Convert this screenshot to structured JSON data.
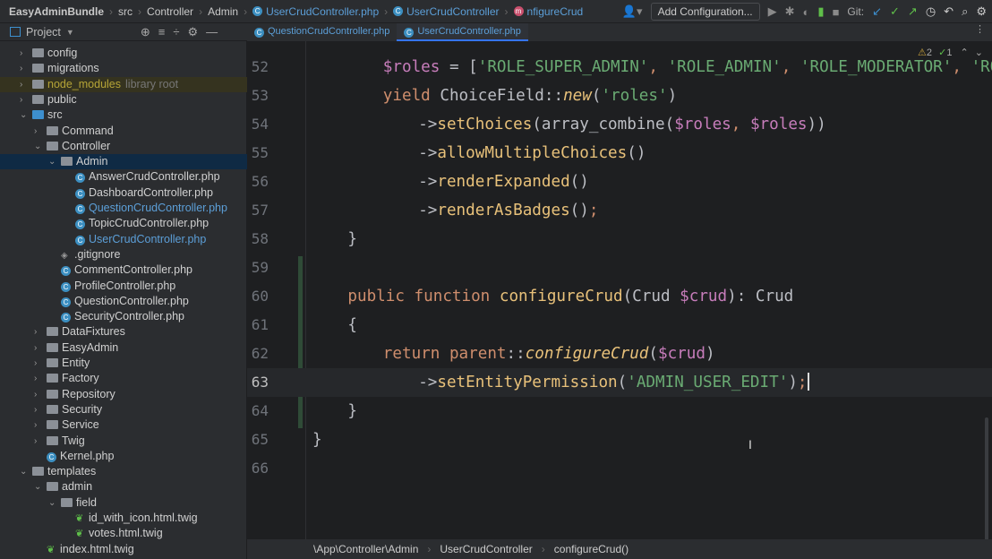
{
  "breadcrumb": [
    "EasyAdminBundle",
    "src",
    "Controller",
    "Admin",
    "UserCrudController.php",
    "UserCrudController",
    "nfigureCrud"
  ],
  "toolbar": {
    "add_config": "Add Configuration...",
    "git_label": "Git:"
  },
  "project": {
    "label": "Project"
  },
  "tabs": [
    {
      "label": "QuestionCrudController.php",
      "active": false
    },
    {
      "label": "UserCrudController.php",
      "active": true
    }
  ],
  "tree": [
    {
      "label": "config",
      "depth": 0,
      "type": "folder",
      "arrow": "›"
    },
    {
      "label": "migrations",
      "depth": 0,
      "type": "folder",
      "arrow": "›"
    },
    {
      "label": "node_modules",
      "extra": "library root",
      "depth": 0,
      "type": "lib",
      "arrow": "›"
    },
    {
      "label": "public",
      "depth": 0,
      "type": "folder",
      "arrow": "›"
    },
    {
      "label": "src",
      "depth": 0,
      "type": "src",
      "arrow": "⌄"
    },
    {
      "label": "Command",
      "depth": 1,
      "type": "folder",
      "arrow": "›"
    },
    {
      "label": "Controller",
      "depth": 1,
      "type": "folder",
      "arrow": "⌄"
    },
    {
      "label": "Admin",
      "depth": 2,
      "type": "folder",
      "arrow": "⌄",
      "selected": true
    },
    {
      "label": "AnswerCrudController.php",
      "depth": 3,
      "type": "php"
    },
    {
      "label": "DashboardController.php",
      "depth": 3,
      "type": "php"
    },
    {
      "label": "QuestionCrudController.php",
      "depth": 3,
      "type": "php",
      "modified": true
    },
    {
      "label": "TopicCrudController.php",
      "depth": 3,
      "type": "php"
    },
    {
      "label": "UserCrudController.php",
      "depth": 3,
      "type": "php",
      "modified": true
    },
    {
      "label": ".gitignore",
      "depth": 2,
      "type": "git"
    },
    {
      "label": "CommentController.php",
      "depth": 2,
      "type": "php"
    },
    {
      "label": "ProfileController.php",
      "depth": 2,
      "type": "php"
    },
    {
      "label": "QuestionController.php",
      "depth": 2,
      "type": "php"
    },
    {
      "label": "SecurityController.php",
      "depth": 2,
      "type": "php"
    },
    {
      "label": "DataFixtures",
      "depth": 1,
      "type": "folder",
      "arrow": "›"
    },
    {
      "label": "EasyAdmin",
      "depth": 1,
      "type": "folder",
      "arrow": "›"
    },
    {
      "label": "Entity",
      "depth": 1,
      "type": "folder",
      "arrow": "›"
    },
    {
      "label": "Factory",
      "depth": 1,
      "type": "folder",
      "arrow": "›"
    },
    {
      "label": "Repository",
      "depth": 1,
      "type": "folder",
      "arrow": "›"
    },
    {
      "label": "Security",
      "depth": 1,
      "type": "folder",
      "arrow": "›"
    },
    {
      "label": "Service",
      "depth": 1,
      "type": "folder",
      "arrow": "›"
    },
    {
      "label": "Twig",
      "depth": 1,
      "type": "folder",
      "arrow": "›"
    },
    {
      "label": "Kernel.php",
      "depth": 1,
      "type": "php"
    },
    {
      "label": "templates",
      "depth": 0,
      "type": "folder",
      "arrow": "⌄"
    },
    {
      "label": "admin",
      "depth": 1,
      "type": "folder",
      "arrow": "⌄"
    },
    {
      "label": "field",
      "depth": 2,
      "type": "folder",
      "arrow": "⌄"
    },
    {
      "label": "id_with_icon.html.twig",
      "depth": 3,
      "type": "twig"
    },
    {
      "label": "votes.html.twig",
      "depth": 3,
      "type": "twig"
    },
    {
      "label": "index.html.twig",
      "depth": 1,
      "type": "twig"
    }
  ],
  "inspections": {
    "warnings": "2",
    "ok": "1"
  },
  "code": [
    {
      "n": "52",
      "indent": 2,
      "t": [
        [
          "var",
          "$roles"
        ],
        [
          "txt",
          " = ["
        ],
        [
          "str",
          "'ROLE_SUPER_ADMIN'"
        ],
        [
          "comma",
          ", "
        ],
        [
          "str",
          "'ROLE_ADMIN'"
        ],
        [
          "comma",
          ", "
        ],
        [
          "str",
          "'ROLE_MODERATOR'"
        ],
        [
          "comma",
          ", "
        ],
        [
          "str",
          "'ROLE_U"
        ]
      ]
    },
    {
      "n": "53",
      "indent": 2,
      "t": [
        [
          "kw",
          "yield "
        ],
        [
          "txt",
          "ChoiceField::"
        ],
        [
          "it",
          "new"
        ],
        [
          "txt",
          "("
        ],
        [
          "str",
          "'roles'"
        ],
        [
          "txt",
          ")"
        ]
      ]
    },
    {
      "n": "54",
      "indent": 3,
      "t": [
        [
          "txt",
          "->"
        ],
        [
          "fn",
          "setChoices"
        ],
        [
          "txt",
          "(array_combine("
        ],
        [
          "var",
          "$roles"
        ],
        [
          "comma",
          ", "
        ],
        [
          "var",
          "$roles"
        ],
        [
          "txt",
          "))"
        ]
      ]
    },
    {
      "n": "55",
      "indent": 3,
      "t": [
        [
          "txt",
          "->"
        ],
        [
          "fn",
          "allowMultipleChoices"
        ],
        [
          "txt",
          "()"
        ]
      ]
    },
    {
      "n": "56",
      "indent": 3,
      "t": [
        [
          "txt",
          "->"
        ],
        [
          "fn",
          "renderExpanded"
        ],
        [
          "txt",
          "()"
        ]
      ]
    },
    {
      "n": "57",
      "indent": 3,
      "t": [
        [
          "txt",
          "->"
        ],
        [
          "fn",
          "renderAsBadges"
        ],
        [
          "txt",
          "()"
        ],
        [
          "comma",
          ";"
        ]
      ]
    },
    {
      "n": "58",
      "indent": 1,
      "t": [
        [
          "txt",
          "}"
        ]
      ]
    },
    {
      "n": "59",
      "indent": 0,
      "t": []
    },
    {
      "n": "60",
      "indent": 1,
      "t": [
        [
          "kw",
          "public function "
        ],
        [
          "fn",
          "configureCrud"
        ],
        [
          "txt",
          "(Crud "
        ],
        [
          "var",
          "$crud"
        ],
        [
          "txt",
          "): Crud"
        ]
      ]
    },
    {
      "n": "61",
      "indent": 1,
      "t": [
        [
          "txt",
          "{"
        ]
      ]
    },
    {
      "n": "62",
      "indent": 2,
      "t": [
        [
          "kw",
          "return "
        ],
        [
          "kw",
          "parent"
        ],
        [
          "txt",
          "::"
        ],
        [
          "it",
          "configureCrud"
        ],
        [
          "txt",
          "("
        ],
        [
          "var",
          "$crud"
        ],
        [
          "txt",
          ")"
        ]
      ]
    },
    {
      "n": "63",
      "indent": 3,
      "t": [
        [
          "txt",
          "->"
        ],
        [
          "fn",
          "setEntityPermission"
        ],
        [
          "txt",
          "("
        ],
        [
          "str",
          "'ADMIN_USER_EDIT'"
        ],
        [
          "txt",
          ")"
        ],
        [
          "comma",
          ";"
        ]
      ],
      "current": true
    },
    {
      "n": "64",
      "indent": 1,
      "t": [
        [
          "txt",
          "}"
        ]
      ]
    },
    {
      "n": "65",
      "indent": 0,
      "t": [
        [
          "txt",
          "}"
        ]
      ]
    },
    {
      "n": "66",
      "indent": 0,
      "t": []
    }
  ],
  "status_path": [
    "\\App\\Controller\\Admin",
    "UserCrudController",
    "configureCrud()"
  ]
}
